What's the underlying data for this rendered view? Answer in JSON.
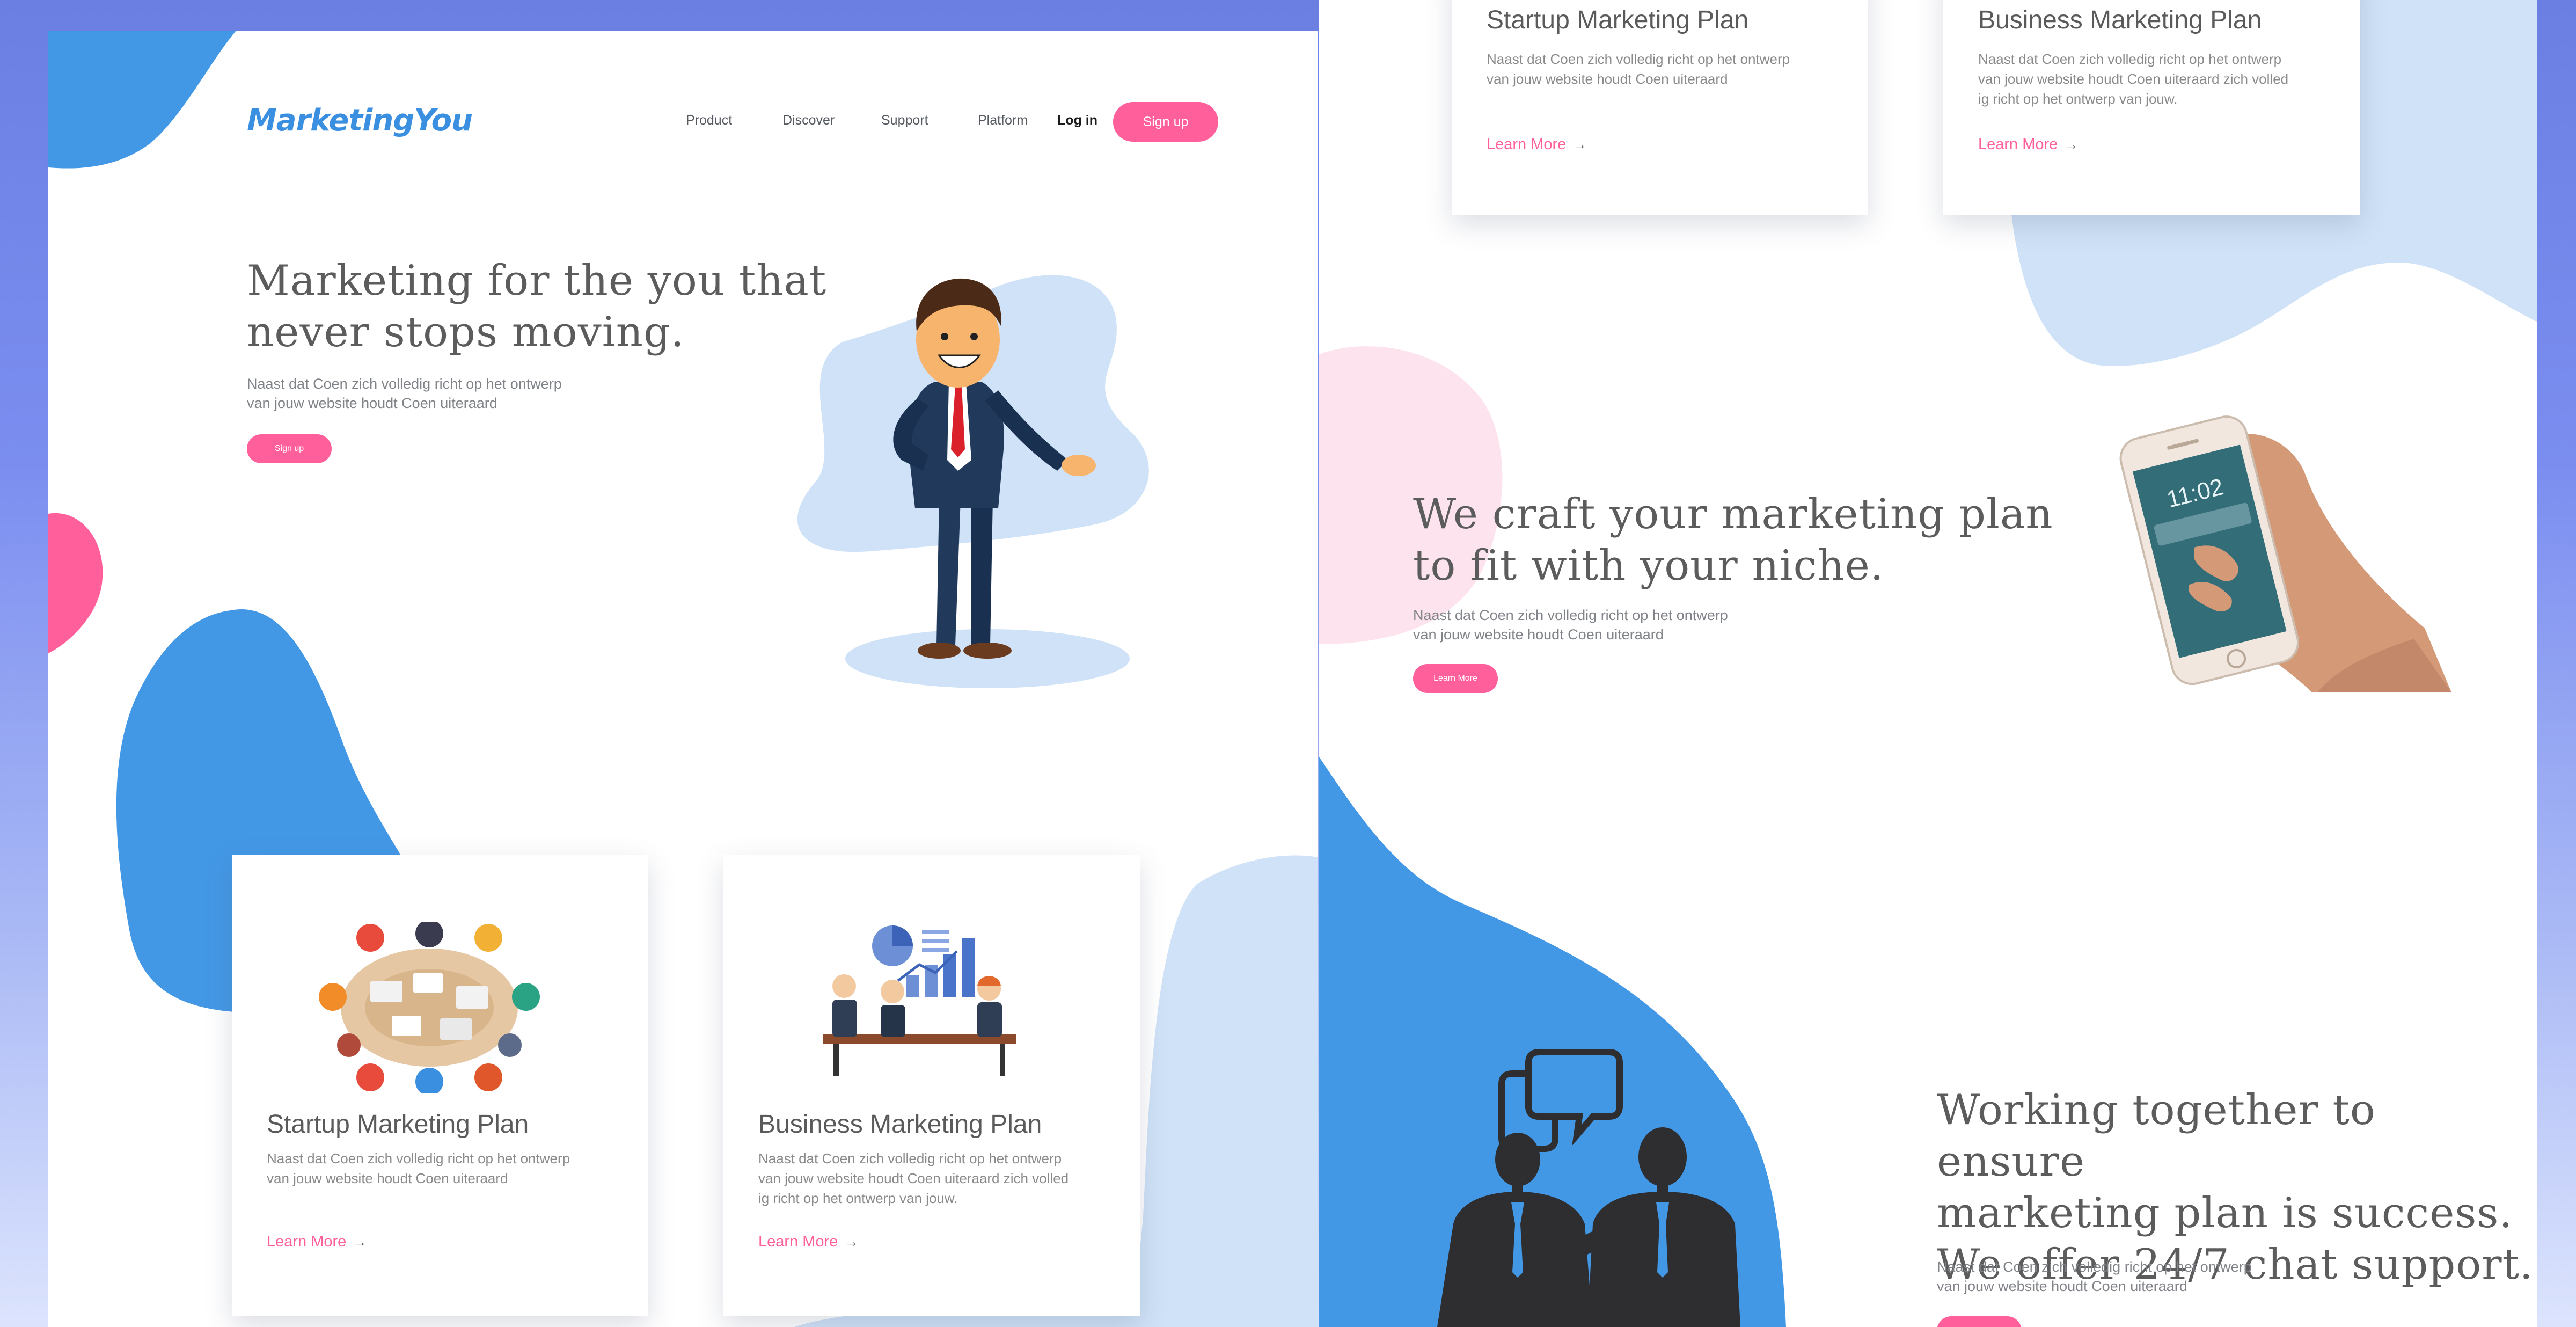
{
  "brand": {
    "logo": "MarketingYou",
    "accent": "#ff5f9b",
    "blue": "#4398e6",
    "light_blue": "#cfe2f7"
  },
  "nav": {
    "items": [
      "Product",
      "Discover",
      "Support",
      "Platform"
    ],
    "login": "Log in",
    "signup": "Sign up"
  },
  "hero": {
    "title": "Marketing for the you that\nnever stops moving.",
    "text": "Naast dat Coen zich volledig richt op het ontwerp\nvan jouw website houdt Coen uiteraard",
    "button": "Sign up"
  },
  "cards": [
    {
      "title": "Startup Marketing Plan",
      "text": "Naast dat Coen zich volledig richt op het ontwerp\nvan jouw website houdt Coen uiteraard",
      "link": "Learn More",
      "icon": "team-meeting-table-illustration"
    },
    {
      "title": "Business Marketing Plan",
      "text": "Naast dat Coen zich volledig richt op het ontwerp\nvan jouw website houdt Coen uiteraard zich volled\nig richt op het ontwerp van jouw.",
      "link": "Learn More",
      "icon": "business-presentation-illustration"
    }
  ],
  "niche": {
    "title": "We craft your marketing plan\nto fit with your niche.",
    "text": "Naast dat Coen zich volledig richt op het ontwerp\nvan jouw website houdt Coen uiteraard",
    "button": "Learn More",
    "phone_time": "11:02"
  },
  "support": {
    "title": "Working together to ensure\nmarketing plan is success.\nWe offer 24/7 chat support.",
    "text": "Naast dat Coen zich volledig richt op het ontwerp\nvan jouw website houdt Coen uiteraard"
  }
}
